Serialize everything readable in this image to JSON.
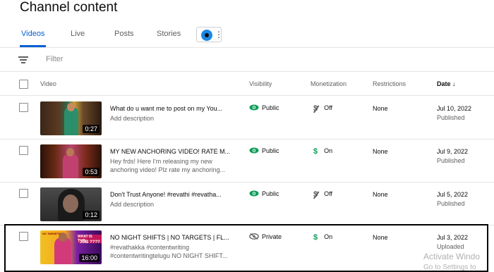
{
  "page": {
    "title": "Channel content"
  },
  "tabs": [
    {
      "label": "Videos",
      "active": true
    },
    {
      "label": "Live",
      "active": false
    },
    {
      "label": "Posts",
      "active": false
    },
    {
      "label": "Stories",
      "active": false
    }
  ],
  "filter": {
    "placeholder": "Filter"
  },
  "table": {
    "columns": {
      "video": "Video",
      "visibility": "Visibility",
      "monetization": "Monetization",
      "restrictions": "Restrictions",
      "date": "Date"
    },
    "rows": [
      {
        "title": "What do u want me to post on my You...",
        "description": "Add description",
        "duration": "0:27",
        "visibility": "Public",
        "monetization": "Off",
        "restrictions": "None",
        "date": "Jul 10, 2022",
        "status": "Published"
      },
      {
        "title": "MY NEW ANCHORING VIDEO! RATE M...",
        "description": "Hey frds! Here I'm releasing my new anchoring video! Plz rate my anchoring...",
        "duration": "0:53",
        "visibility": "Public",
        "monetization": "On",
        "restrictions": "None",
        "date": "Jul 9, 2022",
        "status": "Published"
      },
      {
        "title": "Don't Trust Anyone! #revathi #revatha...",
        "description": "Add description",
        "duration": "0:12",
        "visibility": "Public",
        "monetization": "Off",
        "restrictions": "None",
        "date": "Jul 5, 2022",
        "status": "Published"
      },
      {
        "title": "NO NIGHT SHIFTS | NO TARGETS | FL...",
        "description": "#revathakka #contentwriting #contentwritingtelugu NO NIGHT SHIFT...",
        "duration": "16:00",
        "visibility": "Private",
        "monetization": "On",
        "restrictions": "None",
        "date": "Jul 3, 2022",
        "status": "Uploaded",
        "thumb_text": [
          "NO TARGETS",
          "WHAT IS THIS",
          "JOB ????"
        ]
      }
    ]
  },
  "watermark": {
    "line1": "Activate Windo",
    "line2": "Go to Settings to"
  },
  "colors": {
    "accent": "#065fd4",
    "monetization_on": "#0f9d58",
    "visibility_public": "#0f9d58"
  }
}
